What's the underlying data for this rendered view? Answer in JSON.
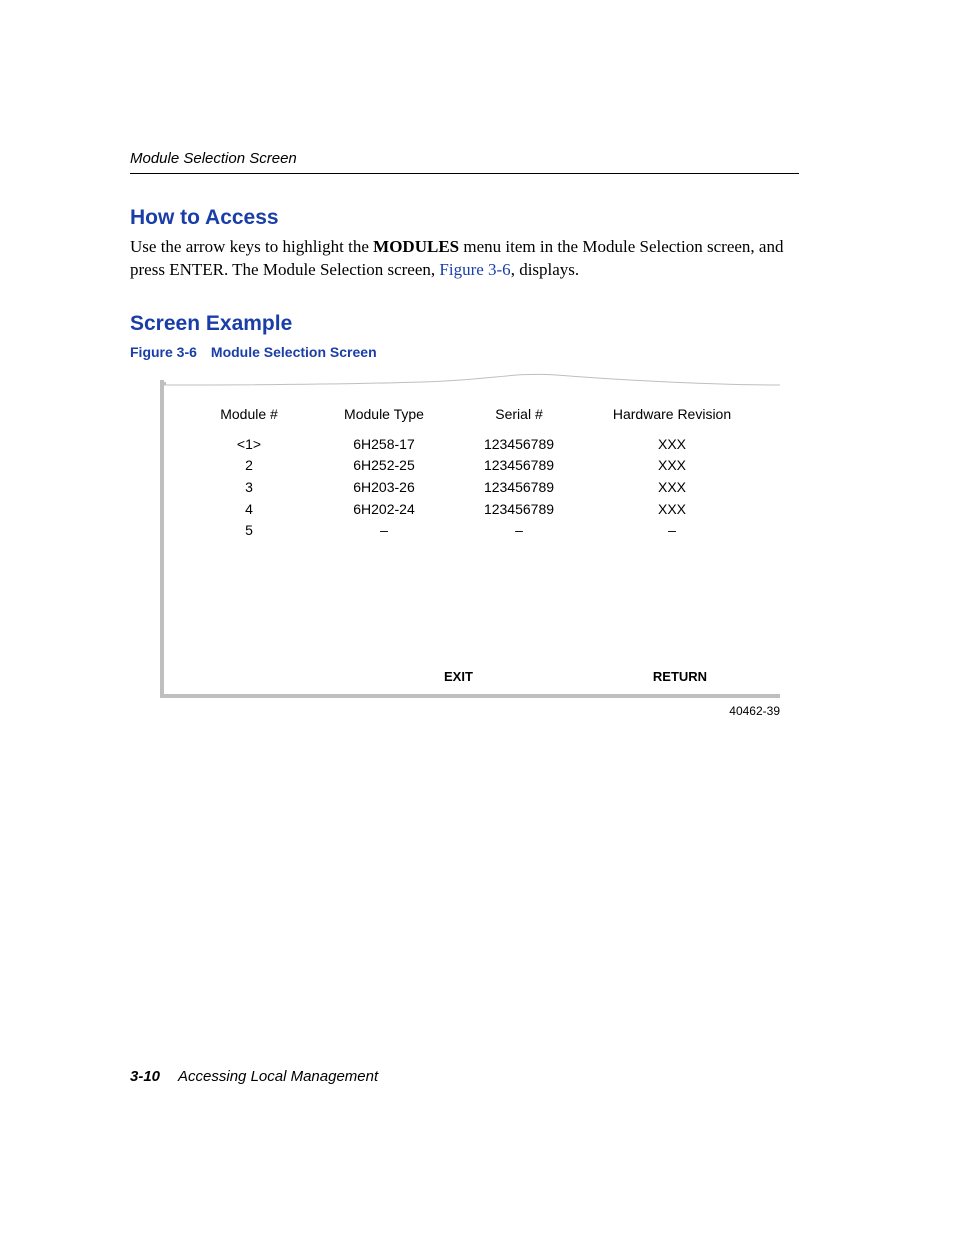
{
  "header": {
    "running_title": "Module Selection Screen"
  },
  "sections": {
    "how_to_access": {
      "title": "How to Access",
      "para_before": "Use the arrow keys to highlight the ",
      "bold_word": "MODULES",
      "para_mid": " menu item in the Module Selection screen, and press ENTER. The Module Selection screen, ",
      "xref": "Figure 3-6",
      "para_after": ", displays."
    },
    "screen_example": {
      "title": "Screen Example",
      "figure_no": "Figure 3-6",
      "figure_title": "Module Selection Screen"
    }
  },
  "screen": {
    "columns": {
      "module_no": "Module #",
      "module_type": "Module Type",
      "serial_no": "Serial #",
      "hw_rev": "Hardware Revision"
    },
    "rows": [
      {
        "module_no": "<1>",
        "module_type": "6H258-17",
        "serial_no": "123456789",
        "hw_rev": "XXX"
      },
      {
        "module_no": "2",
        "module_type": "6H252-25",
        "serial_no": "123456789",
        "hw_rev": "XXX"
      },
      {
        "module_no": "3",
        "module_type": "6H203-26",
        "serial_no": "123456789",
        "hw_rev": "XXX"
      },
      {
        "module_no": "4",
        "module_type": "6H202-24",
        "serial_no": "123456789",
        "hw_rev": "XXX"
      },
      {
        "module_no": "5",
        "module_type": "–",
        "serial_no": "–",
        "hw_rev": "–"
      }
    ],
    "commands": {
      "exit": "EXIT",
      "return": "RETURN"
    },
    "figure_id": "40462-39"
  },
  "footer": {
    "page_no": "3-10",
    "section_title": "Accessing Local Management"
  }
}
